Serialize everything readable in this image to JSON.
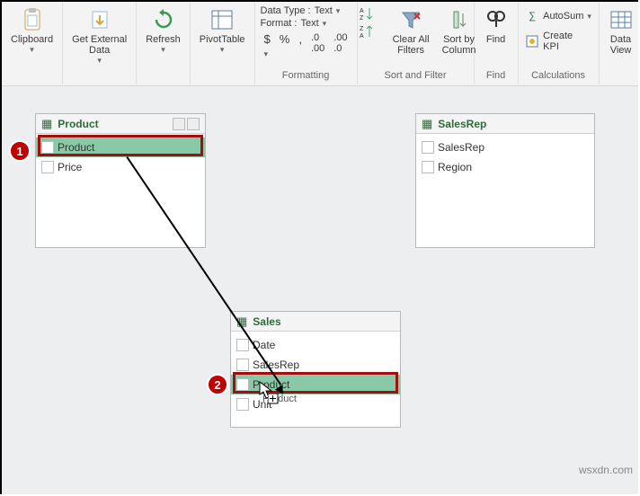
{
  "ribbon": {
    "clipboard": {
      "label": "Clipboard"
    },
    "get_external": {
      "label": "Get External\nData"
    },
    "refresh": {
      "label": "Refresh"
    },
    "pivot": {
      "label": "PivotTable"
    },
    "formatting": {
      "data_type_label": "Data Type :",
      "data_type_value": "Text",
      "format_label": "Format :",
      "format_value": "Text",
      "group_label": "Formatting"
    },
    "sort_filter": {
      "clear_filters": "Clear All\nFilters",
      "sort_by": "Sort by\nColumn",
      "group_label": "Sort and Filter"
    },
    "find": {
      "label": "Find",
      "group_label": "Find"
    },
    "calc": {
      "autosum": "AutoSum",
      "create_kpi": "Create KPI",
      "group_label": "Calculations"
    },
    "data_view": {
      "label": "Data\nView"
    }
  },
  "tables": {
    "product": {
      "title": "Product",
      "fields": [
        "Product",
        "Price"
      ]
    },
    "salesrep": {
      "title": "SalesRep",
      "fields": [
        "SalesRep",
        "Region"
      ]
    },
    "sales": {
      "title": "Sales",
      "fields": [
        "Date",
        "SalesRep",
        "Product",
        "Unit"
      ],
      "drag_ghost": "Product"
    }
  },
  "steps": {
    "one": "1",
    "two": "2"
  },
  "watermark": "wsxdn.com"
}
